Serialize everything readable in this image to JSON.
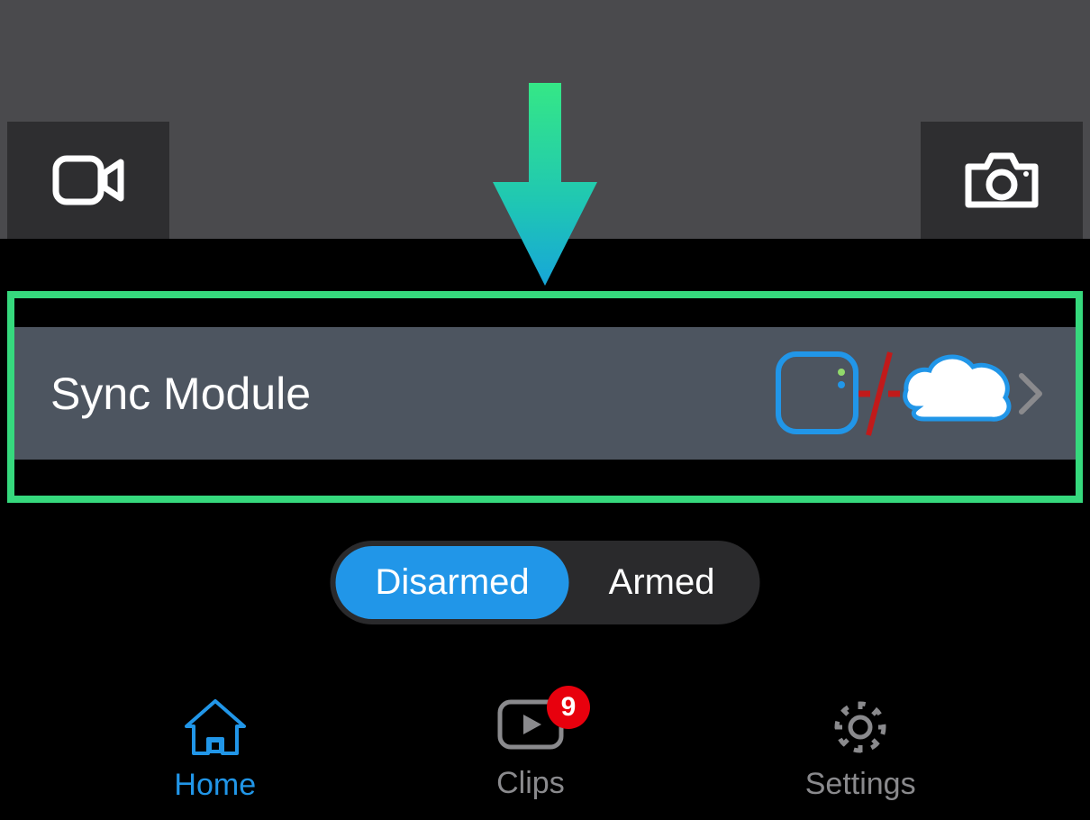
{
  "syncModule": {
    "label": "Sync Module"
  },
  "toggle": {
    "disarmed": "Disarmed",
    "armed": "Armed"
  },
  "nav": {
    "home": "Home",
    "clips": "Clips",
    "clipsBadge": "9",
    "settings": "Settings"
  }
}
